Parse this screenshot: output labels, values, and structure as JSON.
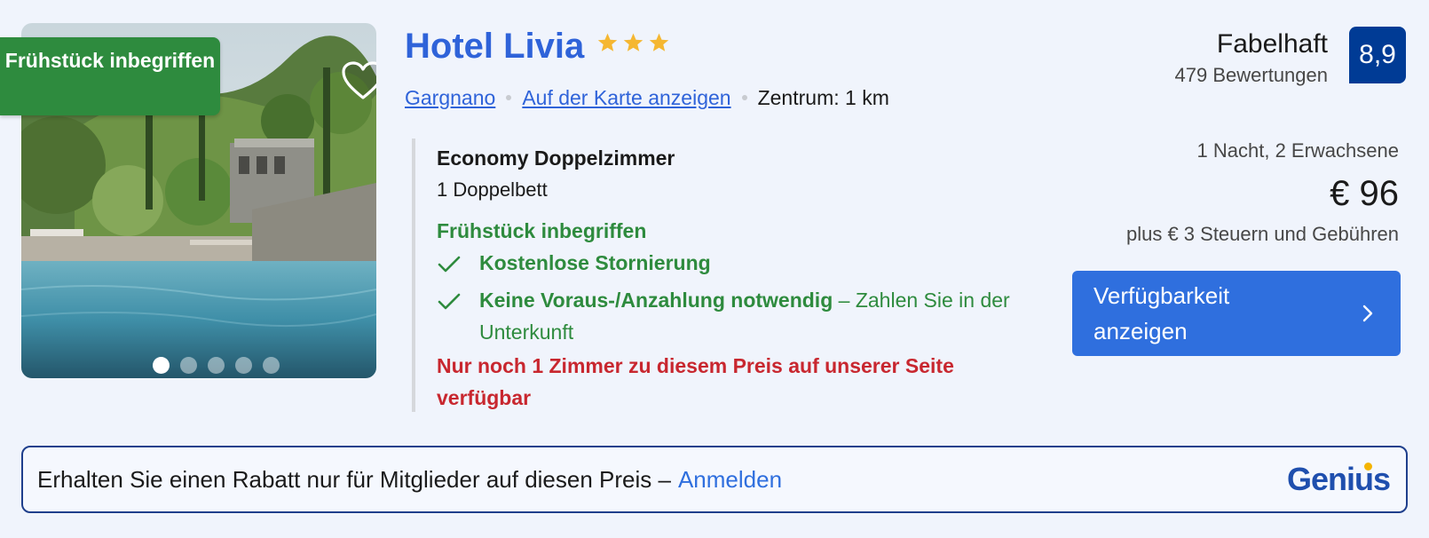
{
  "card": {
    "image": {
      "badge_text": "Frühstück inbegriffen",
      "favorite_icon": "heart-icon",
      "carousel": {
        "count": 5,
        "active_index": 0
      }
    },
    "title": "Hotel Livia",
    "star_rating": 3,
    "location": {
      "city": "Gargnano",
      "map_link": "Auf der Karte anzeigen",
      "distance": "Zentrum: 1 km"
    },
    "review": {
      "word": "Fabelhaft",
      "count_text": "479 Bewertungen",
      "score": "8,9"
    },
    "room": {
      "type": "Economy Doppelzimmer",
      "bed": "1 Doppelbett",
      "breakfast": "Frühstück inbegriffen",
      "perk_cancel": "Kostenlose Stornierung",
      "perk_prepay_bold": "Keine Voraus-/Anzahlung notwendig",
      "perk_prepay_rest": " – Zahlen Sie in der Unterkunft",
      "scarcity": "Nur noch 1 Zimmer zu diesem Preis auf unserer Seite verfügbar"
    },
    "pricing": {
      "occupancy": "1 Nacht, 2 Erwachsene",
      "price": "€ 96",
      "taxes": "plus € 3 Steuern und Gebühren",
      "cta": "Verfügbarkeit anzeigen"
    }
  },
  "genius": {
    "text": "Erhalten Sie einen Rabatt nur für Mitglieder auf diesen Preis –",
    "link": "Anmelden",
    "logo": "Genius"
  },
  "colors": {
    "brand_blue": "#2f63d9",
    "score_bg": "#003b95",
    "green": "#2e8b3e",
    "red": "#c8272f",
    "star_yellow": "#f5b731"
  }
}
